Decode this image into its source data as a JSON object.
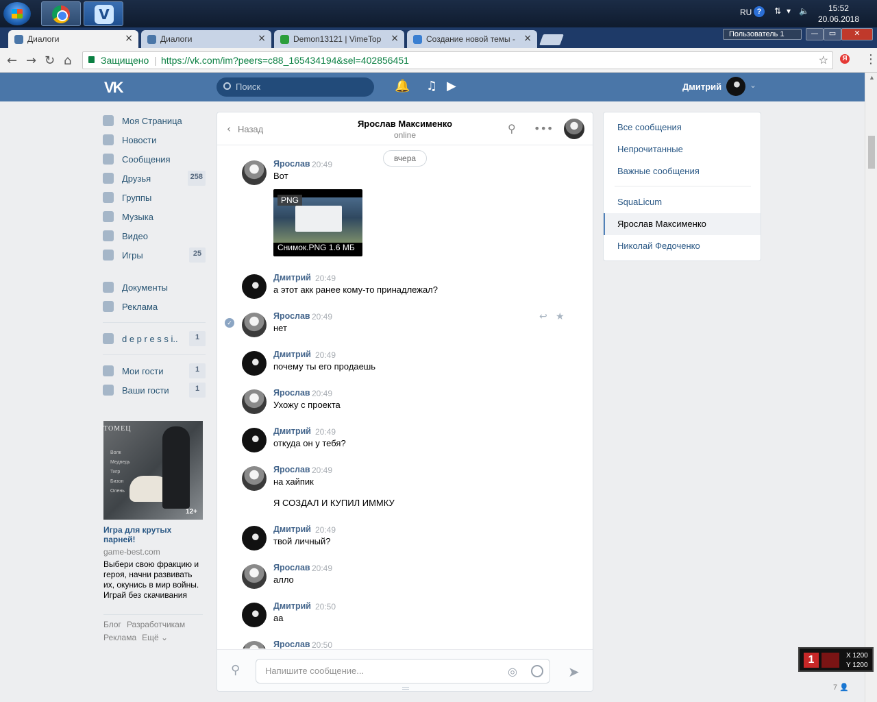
{
  "os": {
    "lang": "RU",
    "clock_time": "15:52",
    "clock_date": "20.06.2018"
  },
  "browser": {
    "tabs": [
      {
        "label": "Диалоги",
        "active": true
      },
      {
        "label": "Диалоги",
        "active": false
      },
      {
        "label": "Demon13121 | VimeTop",
        "active": false
      },
      {
        "label": "Создание новой темы -",
        "active": false
      }
    ],
    "user_profile": "Пользователь 1",
    "secure_label": "Защищено",
    "url": "https://vk.com/im?peers=c88_165434194&sel=402856451"
  },
  "vk_header": {
    "logo": "VK",
    "search_placeholder": "Поиск",
    "user_name": "Дмитрий"
  },
  "left_nav": {
    "items": [
      {
        "label": "Моя Страница",
        "icon": "home-icon"
      },
      {
        "label": "Новости",
        "icon": "news-icon"
      },
      {
        "label": "Сообщения",
        "icon": "messages-icon"
      },
      {
        "label": "Друзья",
        "icon": "friends-icon",
        "count": "258"
      },
      {
        "label": "Группы",
        "icon": "groups-icon"
      },
      {
        "label": "Музыка",
        "icon": "music-icon"
      },
      {
        "label": "Видео",
        "icon": "video-icon"
      },
      {
        "label": "Игры",
        "icon": "games-icon",
        "count": "25"
      }
    ],
    "items2": [
      {
        "label": "Документы",
        "icon": "documents-icon"
      },
      {
        "label": "Реклама",
        "icon": "ads-icon"
      }
    ],
    "group": {
      "label": "d e p r e s s i..",
      "count": "1"
    },
    "guests": [
      {
        "label": "Мои гости",
        "count": "1"
      },
      {
        "label": "Ваши гости",
        "count": "1"
      }
    ]
  },
  "ad": {
    "image_title": "ТОМЕЦ",
    "image_menu": [
      "Волк",
      "Медведь",
      "Тигр",
      "Бизон",
      "Олень"
    ],
    "age": "12+",
    "title": "Игра для крутых парней!",
    "domain": "game-best.com",
    "text": "Выбери свою фракцию и героя, начни развивать их, окунись в мир войны. Играй без скачивания"
  },
  "footer": {
    "links": [
      "Блог",
      "Разработчикам",
      "Реклама",
      "Ещё ⌄"
    ]
  },
  "chat": {
    "back_label": "Назад",
    "peer_name": "Ярослав Максименко",
    "peer_status": "online",
    "date_divider": "вчера",
    "attachment": {
      "badge": "PNG",
      "caption": "Снимок.PNG  1.6 МБ"
    },
    "messages": [
      {
        "author": "Ярослав",
        "time": "20:49",
        "text": "Вот"
      },
      {
        "author": "Дмитрий",
        "time": "20:49",
        "text": "а этот акк ранее кому-то принадлежал?"
      },
      {
        "author": "Ярослав",
        "time": "20:49",
        "text": "нет"
      },
      {
        "author": "Дмитрий",
        "time": "20:49",
        "text": "почему ты его продаешь"
      },
      {
        "author": "Ярослав",
        "time": "20:49",
        "text": "Ухожу с проекта"
      },
      {
        "author": "Дмитрий",
        "time": "20:49",
        "text": "откуда он у тебя?"
      },
      {
        "author": "Ярослав",
        "time": "20:49",
        "text": "на хайпик",
        "text2": "Я СОЗДАЛ И КУПИЛ ИММКУ"
      },
      {
        "author": "Дмитрий",
        "time": "20:49",
        "text": "твой личный?"
      },
      {
        "author": "Ярослав",
        "time": "20:49",
        "text": "алло"
      },
      {
        "author": "Дмитрий",
        "time": "20:50",
        "text": "аа"
      },
      {
        "author": "Ярослав",
        "time": "20:50",
        "text": ""
      }
    ],
    "composer_placeholder": "Напишите сообщение..."
  },
  "right_panel": {
    "filters": [
      "Все сообщения",
      "Непрочитанные",
      "Важные сообщения"
    ],
    "chats": [
      {
        "label": "SquaLicum",
        "active": false
      },
      {
        "label": "Ярослав Максименко",
        "active": true
      },
      {
        "label": "Николай Федоченко",
        "active": false
      }
    ]
  },
  "overlay": {
    "digit": "1",
    "x_readout": "X 1200",
    "y_readout": "Y 1200"
  },
  "online_count": "7"
}
